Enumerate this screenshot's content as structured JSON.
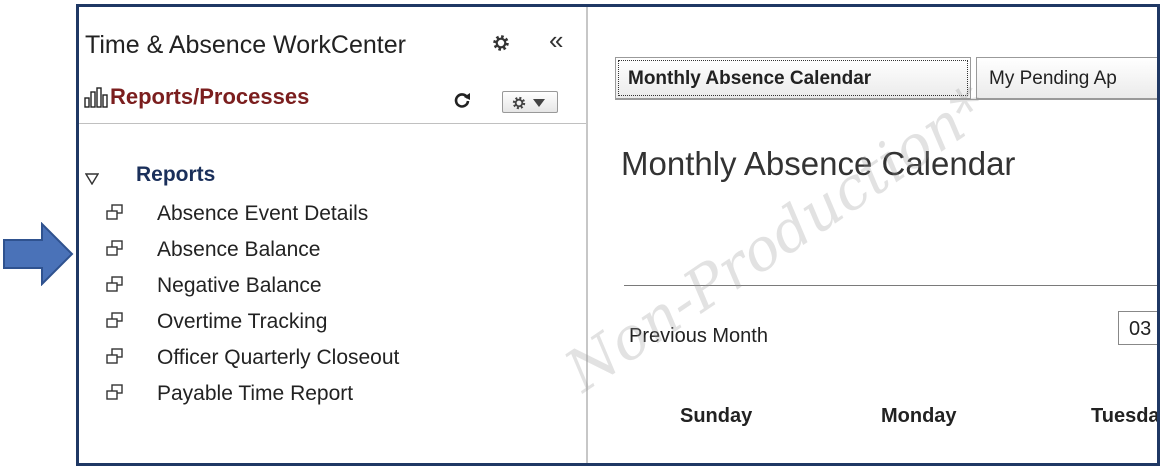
{
  "workcenter": {
    "title": "Time & Absence WorkCenter",
    "collapse_glyph": "«"
  },
  "pagelet": {
    "title": "Reports/Processes"
  },
  "reports": {
    "section_label": "Reports",
    "items": [
      {
        "label": "Absence Event Details"
      },
      {
        "label": "Absence Balance"
      },
      {
        "label": "Negative Balance"
      },
      {
        "label": "Overtime Tracking"
      },
      {
        "label": "Officer Quarterly Closeout"
      },
      {
        "label": "Payable Time Report"
      }
    ]
  },
  "tabs": [
    {
      "label": "Monthly Absence Calendar",
      "active": true
    },
    {
      "label": "My Pending Ap",
      "active": false
    }
  ],
  "main": {
    "page_title": "Monthly Absence Calendar",
    "previous_month": "Previous Month",
    "month_value": "03",
    "day_headers": [
      "Sunday",
      "Monday",
      "Tuesda"
    ]
  },
  "watermark": "Non-Production*",
  "colors": {
    "frame_border": "#1f3864",
    "callout_arrow": "#4a72b8",
    "pagelet_title": "#7b1e1e",
    "reports_label": "#1a2f5a"
  },
  "icons": {
    "callout": "right-arrow",
    "workcenter_settings": "gear",
    "collapse": "double-chevron-left",
    "pagelet": "bar-chart",
    "refresh": "refresh",
    "options": "gear-with-dropdown",
    "section_toggle": "triangle-down",
    "report_item": "new-window"
  }
}
